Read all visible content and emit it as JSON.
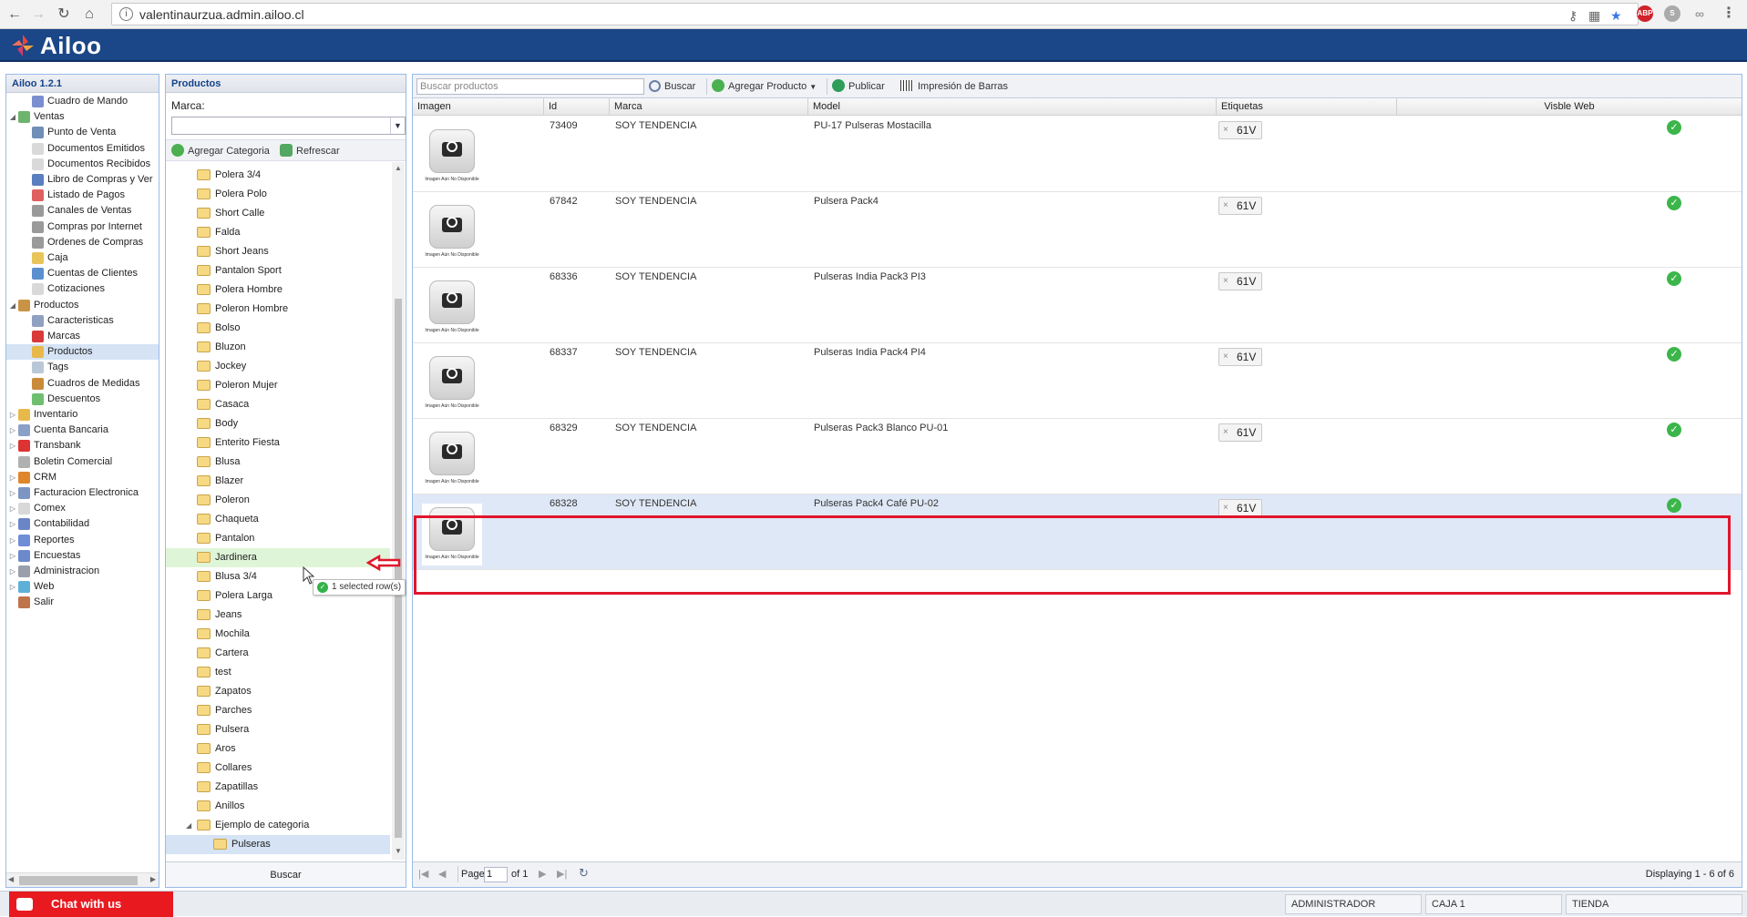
{
  "browser": {
    "url": "valentinaurzua.admin.ailoo.cl"
  },
  "app": {
    "logo": "Ailoo",
    "version_title": "Ailoo 1.2.1"
  },
  "nav": {
    "items": [
      {
        "label": "Cuadro de Mando",
        "level": 1,
        "icon": "chart-icon"
      },
      {
        "label": "Ventas",
        "level": 0,
        "expanded": true,
        "icon": "ventas-icon"
      },
      {
        "label": "Punto de Venta",
        "level": 1,
        "icon": "pos-icon"
      },
      {
        "label": "Documentos Emitidos",
        "level": 1,
        "icon": "document-icon"
      },
      {
        "label": "Documentos Recibidos",
        "level": 1,
        "icon": "document-icon"
      },
      {
        "label": "Libro de Compras y Ver",
        "level": 1,
        "icon": "book-icon"
      },
      {
        "label": "Listado de Pagos",
        "level": 1,
        "icon": "payments-icon"
      },
      {
        "label": "Canales de Ventas",
        "level": 1,
        "icon": "cart-icon"
      },
      {
        "label": "Compras por Internet",
        "level": 1,
        "icon": "cart-icon"
      },
      {
        "label": "Ordenes de Compras",
        "level": 1,
        "icon": "cart-icon"
      },
      {
        "label": "Caja",
        "level": 1,
        "icon": "cashbox-icon"
      },
      {
        "label": "Cuentas de Clientes",
        "level": 1,
        "icon": "accounts-icon"
      },
      {
        "label": "Cotizaciones",
        "level": 1,
        "icon": "document-icon"
      },
      {
        "label": "Productos",
        "level": 0,
        "expanded": true,
        "icon": "productos-icon"
      },
      {
        "label": "Caracteristicas",
        "level": 1,
        "icon": "grid-icon"
      },
      {
        "label": "Marcas",
        "level": 1,
        "icon": "ribbon-icon"
      },
      {
        "label": "Productos",
        "level": 1,
        "icon": "box-icon",
        "selected": true
      },
      {
        "label": "Tags",
        "level": 1,
        "icon": "tag-icon"
      },
      {
        "label": "Cuadros de Medidas",
        "level": 1,
        "icon": "ruler-icon"
      },
      {
        "label": "Descuentos",
        "level": 1,
        "icon": "discount-icon"
      },
      {
        "label": "Inventario",
        "level": 0,
        "icon": "inventory-icon"
      },
      {
        "label": "Cuenta Bancaria",
        "level": 0,
        "icon": "bank-icon"
      },
      {
        "label": "Transbank",
        "level": 0,
        "icon": "transbank-icon"
      },
      {
        "label": "Boletin Comercial",
        "level": 0,
        "icon": "newsletter-icon"
      },
      {
        "label": "CRM",
        "level": 0,
        "icon": "crm-icon"
      },
      {
        "label": "Facturacion Electronica",
        "level": 0,
        "icon": "invoice-icon"
      },
      {
        "label": "Comex",
        "level": 0,
        "icon": "comex-icon"
      },
      {
        "label": "Contabilidad",
        "level": 0,
        "icon": "accounting-icon"
      },
      {
        "label": "Reportes",
        "level": 0,
        "icon": "reports-icon"
      },
      {
        "label": "Encuestas",
        "level": 0,
        "icon": "survey-icon"
      },
      {
        "label": "Administracion",
        "level": 0,
        "icon": "gear-icon"
      },
      {
        "label": "Web",
        "level": 0,
        "icon": "globe-icon"
      },
      {
        "label": "Salir",
        "level": 0,
        "icon": "exit-icon"
      }
    ]
  },
  "categories": {
    "title": "Productos",
    "marca_label": "Marca:",
    "agregar_categoria": "Agregar Categoria",
    "refrescar": "Refrescar",
    "buscar": "Buscar",
    "items": [
      "Polera 3/4",
      "Polera Polo",
      "Short Calle",
      "Falda",
      "Short Jeans",
      "Pantalon Sport",
      "Polera Hombre",
      "Poleron Hombre",
      "Bolso",
      "Bluzon",
      "Jockey",
      "Poleron Mujer",
      "Casaca",
      "Body",
      "Enterito Fiesta",
      "Blusa",
      "Blazer",
      "Poleron",
      "Chaqueta",
      "Pantalon",
      "Jardinera",
      "Blusa 3/4",
      "Polera Larga",
      "Jeans",
      "Mochila",
      "Cartera",
      "test",
      "Zapatos",
      "Parches",
      "Pulsera",
      "Aros",
      "Collares",
      "Zapatillas",
      "Anillos",
      "Ejemplo de categoria"
    ],
    "subitem": "Pulseras",
    "tooltip": "1 selected row(s)"
  },
  "grid": {
    "search_placeholder": "Buscar productos",
    "buscar": "Buscar",
    "agregar_producto": "Agregar Producto",
    "publicar": "Publicar",
    "impresion": "Impresión de Barras",
    "columns": [
      "Imagen",
      "Id",
      "Marca",
      "Model",
      "Etiquetas",
      "Visble Web"
    ],
    "image_caption": "Imagen Aún No Disponible",
    "rows": [
      {
        "id": "73409",
        "marca": "SOY TENDENCIA",
        "model": "PU-17 Pulseras Mostacilla",
        "tag": "61V"
      },
      {
        "id": "67842",
        "marca": "SOY TENDENCIA",
        "model": "Pulsera Pack4",
        "tag": "61V"
      },
      {
        "id": "68336",
        "marca": "SOY TENDENCIA",
        "model": "Pulseras India Pack3 PI3",
        "tag": "61V"
      },
      {
        "id": "68337",
        "marca": "SOY TENDENCIA",
        "model": "Pulseras India Pack4 PI4",
        "tag": "61V"
      },
      {
        "id": "68329",
        "marca": "SOY TENDENCIA",
        "model": "Pulseras Pack3 Blanco PU-01",
        "tag": "61V"
      },
      {
        "id": "68328",
        "marca": "SOY TENDENCIA",
        "model": "Pulseras Pack4 Café PU-02",
        "tag": "61V",
        "selected": true
      }
    ],
    "pager": {
      "page_label": "Page",
      "page_value": "1",
      "of_label": "of 1",
      "displaying": "Displaying 1 - 6 of 6"
    }
  },
  "statusbar": {
    "chat": "Chat with us",
    "user": "ADMINISTRADOR",
    "caja": "CAJA 1",
    "tienda": "TIENDA"
  },
  "colors": {
    "header_blue": "#1b4687",
    "selection": "#dfe8f6",
    "highlight_red": "#e0162b",
    "chat_red": "#e81a20"
  }
}
